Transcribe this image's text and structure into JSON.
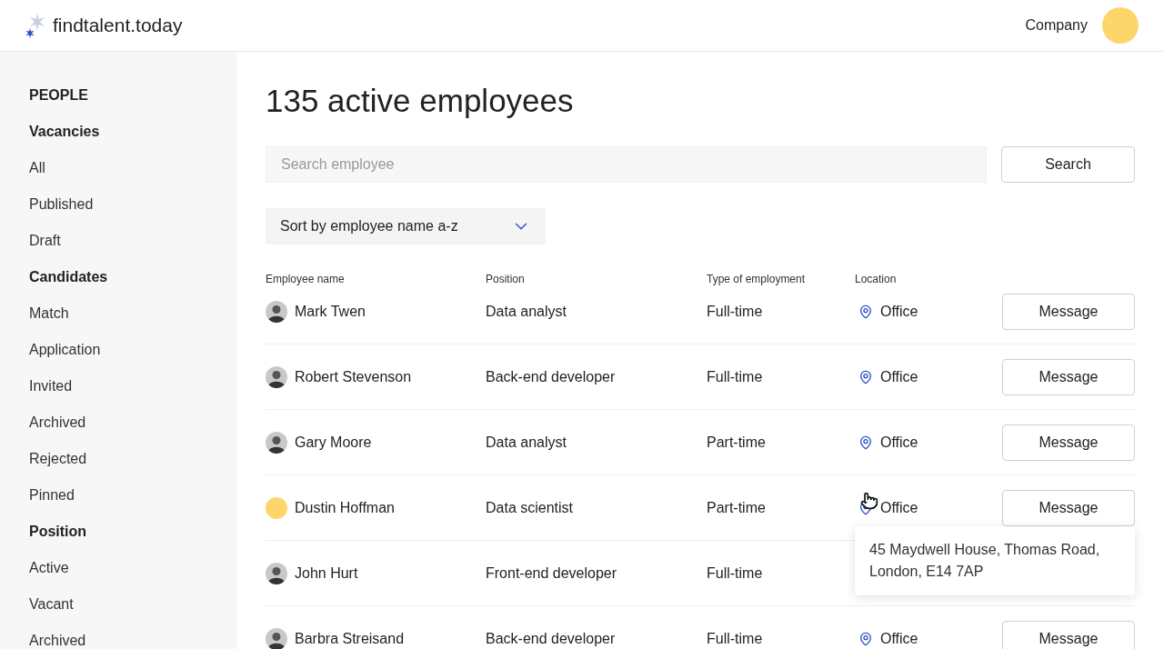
{
  "header": {
    "brand": "findtalent.today",
    "company": "Company"
  },
  "sidebar": {
    "items": [
      {
        "label": "PEOPLE",
        "kind": "section"
      },
      {
        "label": "Vacancies",
        "kind": "group"
      },
      {
        "label": "All",
        "kind": "item"
      },
      {
        "label": "Published",
        "kind": "item"
      },
      {
        "label": "Draft",
        "kind": "item"
      },
      {
        "label": "Candidates",
        "kind": "group"
      },
      {
        "label": "Match",
        "kind": "item"
      },
      {
        "label": "Application",
        "kind": "item"
      },
      {
        "label": "Invited",
        "kind": "item"
      },
      {
        "label": "Archived",
        "kind": "item"
      },
      {
        "label": "Rejected",
        "kind": "item"
      },
      {
        "label": "Pinned",
        "kind": "item"
      },
      {
        "label": "Position",
        "kind": "group"
      },
      {
        "label": "Active",
        "kind": "item"
      },
      {
        "label": "Vacant",
        "kind": "item"
      },
      {
        "label": "Archived",
        "kind": "item"
      }
    ]
  },
  "title": "135 active employees",
  "search": {
    "placeholder": "Search employee",
    "button": "Search"
  },
  "sort": {
    "value": "Sort by employee name a-z"
  },
  "table": {
    "columns": [
      "Employee name",
      "Position",
      "Type of employment",
      "Location"
    ],
    "rows": [
      {
        "kind": "photo",
        "name": "Mark Twen",
        "position": "Data analyst",
        "type": "Full-time",
        "location": "Office",
        "action": "Message"
      },
      {
        "kind": "photo",
        "name": "Robert Stevenson",
        "position": "Back-end developer",
        "type": "Full-time",
        "location": "Office",
        "action": "Message"
      },
      {
        "kind": "photo",
        "name": "Gary Moore",
        "position": "Data analyst",
        "type": "Part-time",
        "location": "Office",
        "action": "Message"
      },
      {
        "kind": "plain",
        "name": "Dustin Hoffman",
        "position": "Data scientist",
        "type": "Part-time",
        "location": "Office",
        "action": "Message",
        "tooltip": "45 Maydwell House, Thomas Road, London, E14 7AP"
      },
      {
        "kind": "photo",
        "name": "John Hurt",
        "position": "Front-end developer",
        "type": "Full-time"
      },
      {
        "kind": "photo",
        "name": "Barbra Streisand",
        "position": "Back-end developer",
        "type": "Full-time",
        "location": "Office",
        "action": "Message"
      }
    ]
  }
}
